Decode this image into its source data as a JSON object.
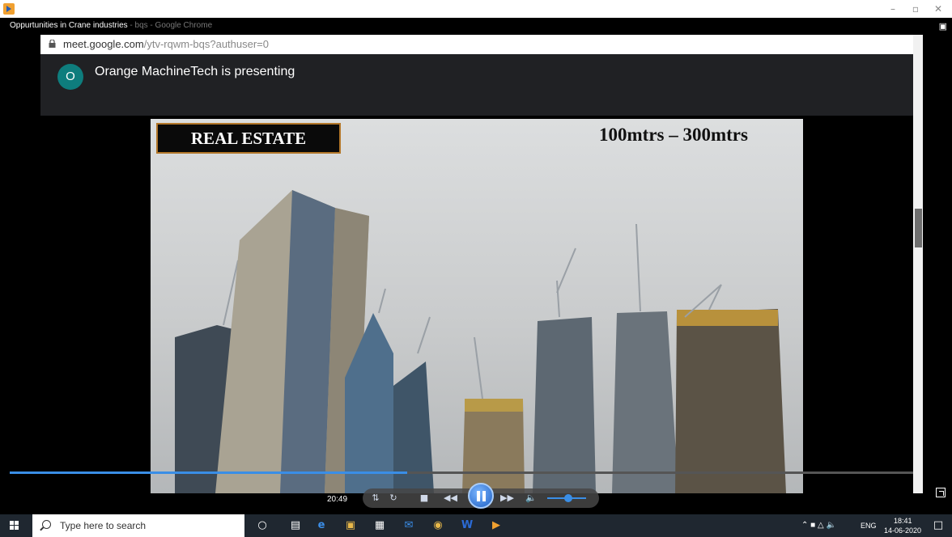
{
  "window": {
    "title_main": "Oppurtunities in Crane industries",
    "title_rest": " - bqs - Google Chrome",
    "minimize": "–",
    "maximize": "▫",
    "close": "✕"
  },
  "browser": {
    "url_host": "meet.google.com",
    "url_path": "/ytv-rqwm-bqs?authuser=0"
  },
  "meet": {
    "avatar_letter": "O",
    "presenting_text": "Orange MachineTech is presenting"
  },
  "slide": {
    "heading": "REAL ESTATE",
    "height_range": "100mtrs – 300mtrs"
  },
  "player": {
    "time": "20:49",
    "progress_fraction": 0.44,
    "volume_fraction": 0.55
  },
  "taskbar": {
    "search_placeholder": "Type here to search",
    "language": "ENG",
    "clock_time": "18:41",
    "clock_date": "14-06-2020"
  },
  "colors": {
    "accent": "#3a8ee6",
    "meet_avatar": "#0e7d7d",
    "heading_border": "#b3772a"
  }
}
